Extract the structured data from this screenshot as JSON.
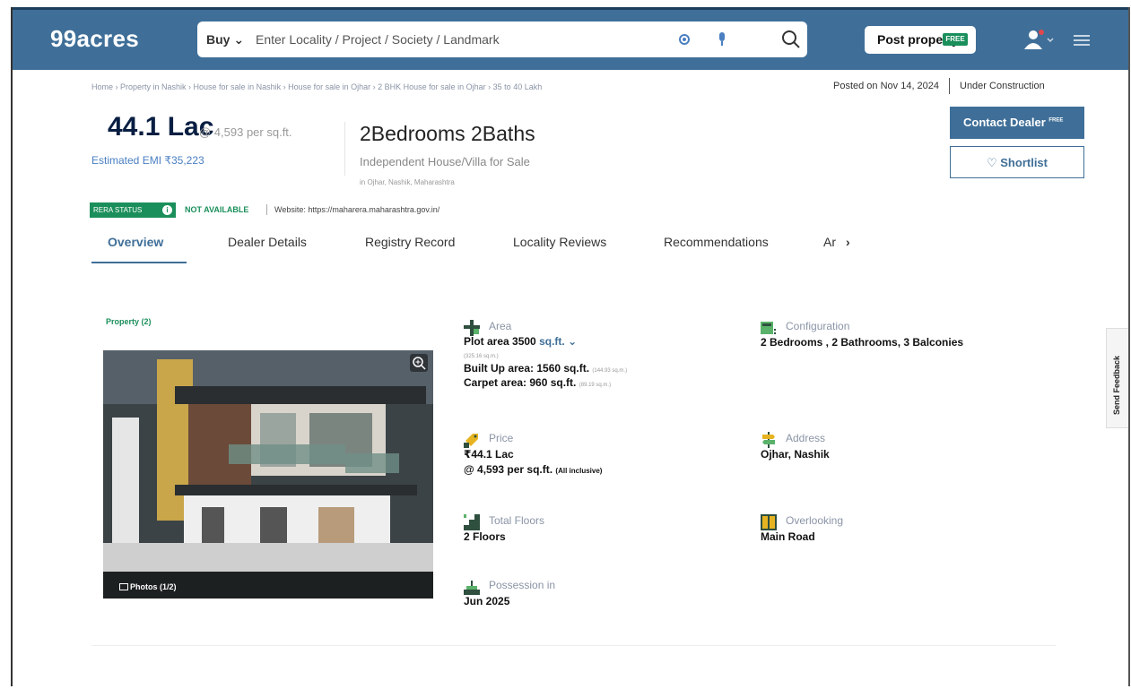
{
  "header": {
    "logo": "99acres",
    "buy_label": "Buy",
    "search_placeholder": "Enter Locality / Project / Society / Landmark",
    "post_label": "Post property",
    "free_tag": "FREE"
  },
  "breadcrumb": "Home › Property in Nashik › House for sale in Nashik › House for sale in Ojhar › 2 BHK House for sale in Ojhar › 35 to 40 Lakh",
  "meta": {
    "posted": "Posted on Nov 14, 2024",
    "status": "Under Construction"
  },
  "price": {
    "amount": "44.1 Lac",
    "per_sqft": "@ 4,593 per sq.ft.",
    "emi": "Estimated EMI ₹35,223"
  },
  "listing": {
    "title": "2Bedrooms 2Baths",
    "subtitle": "Independent House/Villa for Sale",
    "location": "in Ojhar, Nashik, Maharashtra"
  },
  "actions": {
    "contact": "Contact Dealer",
    "contact_sup": "FREE",
    "shortlist": "Shortlist"
  },
  "rera": {
    "label": "RERA STATUS",
    "value": "NOT AVAILABLE",
    "website": "Website: https://maharera.maharashtra.gov.in/"
  },
  "tabs": [
    "Overview",
    "Dealer Details",
    "Registry Record",
    "Locality Reviews",
    "Recommendations",
    "Ar"
  ],
  "property": {
    "label": "Property (2)",
    "photos": "Photos (1/2)"
  },
  "details": {
    "area_title": "Area",
    "plot_area": "Plot area 3500",
    "plot_unit": "sq.ft.",
    "plot_sqm": "(325.16 sq.m.)",
    "built_up": "Built Up area: 1560 sq.ft.",
    "built_up_sqm": "(144.93 sq.m.)",
    "carpet": "Carpet area: 960 sq.ft.",
    "carpet_sqm": "(89.19 sq.m.)",
    "config_title": "Configuration",
    "config_value": "2 Bedrooms , 2 Bathrooms, 3 Balconies",
    "price_title": "Price",
    "price_value": "₹44.1 Lac",
    "price_rate": "@ 4,593 per sq.ft.",
    "price_note": "(All inclusive)",
    "address_title": "Address",
    "address_value": "Ojhar, Nashik",
    "floors_title": "Total Floors",
    "floors_value": "2 Floors",
    "overlooking_title": "Overlooking",
    "overlooking_value": "Main Road",
    "possession_title": "Possession in",
    "possession_value": "Jun 2025"
  },
  "feedback": "Send Feedback",
  "colors": {
    "header_blue": "#3f6f98",
    "green": "#1b8f5b"
  }
}
